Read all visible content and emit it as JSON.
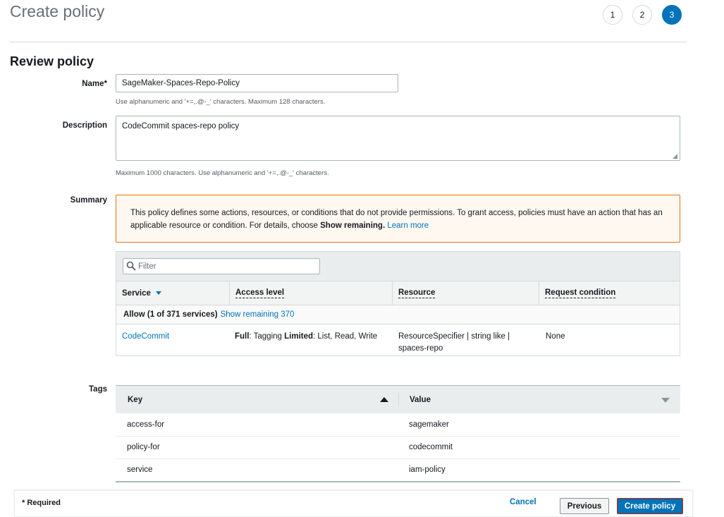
{
  "page": {
    "title": "Create policy"
  },
  "steps": [
    {
      "label": "1",
      "active": false
    },
    {
      "label": "2",
      "active": false
    },
    {
      "label": "3",
      "active": true
    }
  ],
  "section_title": "Review policy",
  "form": {
    "name_label": "Name*",
    "name_value": "SageMaker-Spaces-Repo-Policy",
    "name_hint": "Use alphanumeric and '+=,.@-_' characters. Maximum 128 characters.",
    "description_label": "Description",
    "description_value": "CodeCommit spaces-repo policy",
    "description_hint": "Maximum 1000 characters. Use alphanumeric and '+=,.@-_' characters.",
    "summary_label": "Summary",
    "tags_label": "Tags"
  },
  "alert": {
    "text_before": "This policy defines some actions, resources, or conditions that do not provide permissions. To grant access, policies must have an action that has an applicable resource or condition. For details, choose ",
    "bold": "Show remaining.",
    "link": "Learn more"
  },
  "summary": {
    "filter_placeholder": "Filter",
    "columns": [
      "Service",
      "Access level",
      "Resource",
      "Request condition"
    ],
    "group": {
      "label": "Allow (1 of 371 services)",
      "link": "Show remaining 370"
    },
    "row": {
      "service": "CodeCommit",
      "access_full_label": "Full",
      "access_full_value": ": Tagging ",
      "access_limited_label": "Limited",
      "access_limited_value": ": List, Read, Write",
      "resource_line1": "ResourceSpecifier | string like |",
      "resource_line2": "spaces-repo",
      "condition": "None"
    }
  },
  "tags": {
    "columns": {
      "key": "Key",
      "value": "Value"
    },
    "rows": [
      {
        "key": "access-for",
        "value": "sagemaker"
      },
      {
        "key": "policy-for",
        "value": "codecommit"
      },
      {
        "key": "service",
        "value": "iam-policy"
      }
    ]
  },
  "footer": {
    "required": "* Required",
    "cancel": "Cancel",
    "previous": "Previous",
    "create": "Create policy"
  },
  "colors": {
    "accent": "#0073bb",
    "warning_border": "#ec7211",
    "warning_bg": "#fef8f1"
  }
}
